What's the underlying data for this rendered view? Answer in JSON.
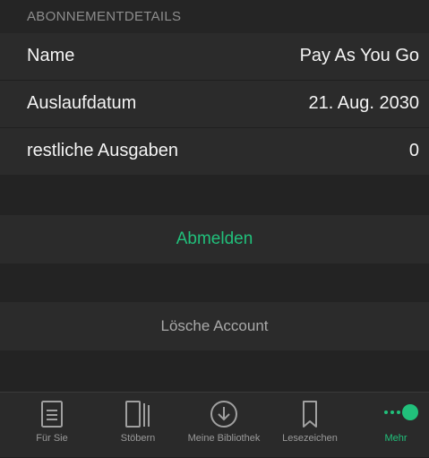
{
  "section": {
    "title": "ABONNEMENTDETAILS"
  },
  "details": [
    {
      "label": "Name",
      "value": "Pay As You Go"
    },
    {
      "label": "Auslaufdatum",
      "value": "21. Aug. 2030"
    },
    {
      "label": "restliche Ausgaben",
      "value": "0"
    }
  ],
  "actions": {
    "logout_label": "Abmelden",
    "delete_label": "Lösche Account"
  },
  "tabbar": {
    "tabs": [
      {
        "label": "Für Sie",
        "icon": "document-icon"
      },
      {
        "label": "Stöbern",
        "icon": "browse-icon"
      },
      {
        "label": "Meine Bibliothek",
        "icon": "download-icon"
      },
      {
        "label": "Lesezeichen",
        "icon": "bookmark-icon"
      },
      {
        "label": "Mehr",
        "icon": "more-icon",
        "active": true
      }
    ]
  },
  "colors": {
    "accent": "#21c07b",
    "background": "#1f1f1f",
    "row": "#2b2b2b",
    "muted_text": "#8d8d8d"
  }
}
